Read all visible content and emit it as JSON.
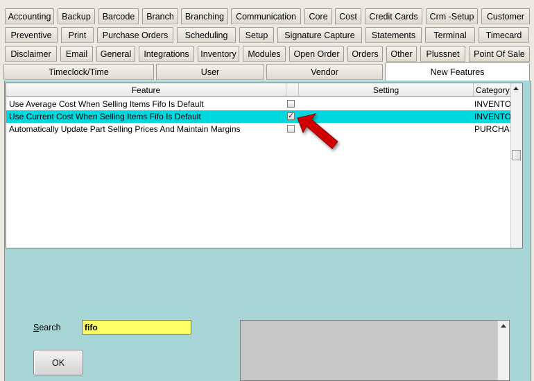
{
  "tabs": {
    "row1": [
      "Accounting",
      "Backup",
      "Barcode",
      "Branch",
      "Branching",
      "Communication",
      "Core",
      "Cost",
      "Credit Cards",
      "Crm -Setup",
      "Customer"
    ],
    "row2": [
      "Preventive",
      "Print",
      "Purchase Orders",
      "Scheduling",
      "Setup",
      "Signature Capture",
      "Statements",
      "Terminal",
      "Timecard"
    ],
    "row3": [
      "Disclaimer",
      "Email",
      "General",
      "Integrations",
      "Inventory",
      "Modules",
      "Open Order",
      "Orders",
      "Other",
      "Plussnet",
      "Point Of Sale"
    ],
    "row4": [
      "Timeclock/Time",
      "User",
      "Vendor",
      "New Features"
    ],
    "active": "New Features"
  },
  "grid": {
    "columns": {
      "feature": "Feature",
      "setting": "Setting",
      "category": "Category"
    },
    "rows": [
      {
        "feature": "Use Average Cost When Selling Items Fifo Is Default",
        "checked": false,
        "category": "INVENTORY",
        "selected": false
      },
      {
        "feature": "Use Current Cost When Selling Items Fifo Is Default",
        "checked": true,
        "category": "INVENTORY",
        "selected": true
      },
      {
        "feature": "Automatically Update Part Selling Prices And Maintain Margins",
        "checked": false,
        "category": "PURCHASE",
        "selected": false
      }
    ]
  },
  "search": {
    "label": "Search",
    "value": "fifo"
  },
  "ok_label": "OK",
  "colors": {
    "selection": "#00d8e0",
    "panel": "#a8d6d6",
    "search_bg": "#ffff66",
    "arrow": "#d10000"
  }
}
